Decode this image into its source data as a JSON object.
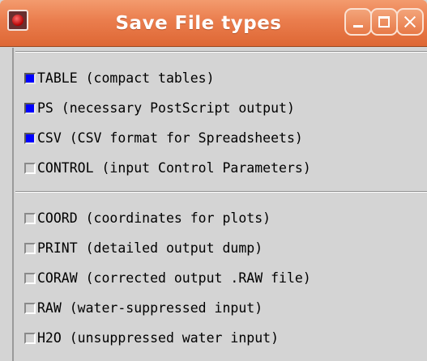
{
  "window": {
    "title": "Save File types",
    "buttons": {
      "minimize_icon": "minimize-icon",
      "maximize_icon": "maximize-icon",
      "close_icon": "close-icon"
    },
    "titlebar_color": "#e8784a",
    "check_color": "#0000ff"
  },
  "group1": [
    {
      "label": "TABLE (compact tables)",
      "checked": true
    },
    {
      "label": "PS (necessary PostScript output)",
      "checked": true
    },
    {
      "label": "CSV (CSV format for Spreadsheets)",
      "checked": true
    },
    {
      "label": "CONTROL (input Control Parameters)",
      "checked": false
    }
  ],
  "group2": [
    {
      "label": "COORD (coordinates for plots)",
      "checked": false
    },
    {
      "label": "PRINT (detailed output dump)",
      "checked": false
    },
    {
      "label": "CORAW (corrected output .RAW file)",
      "checked": false
    },
    {
      "label": "RAW (water-suppressed input)",
      "checked": false
    },
    {
      "label": "H2O (unsuppressed water input)",
      "checked": false
    }
  ]
}
